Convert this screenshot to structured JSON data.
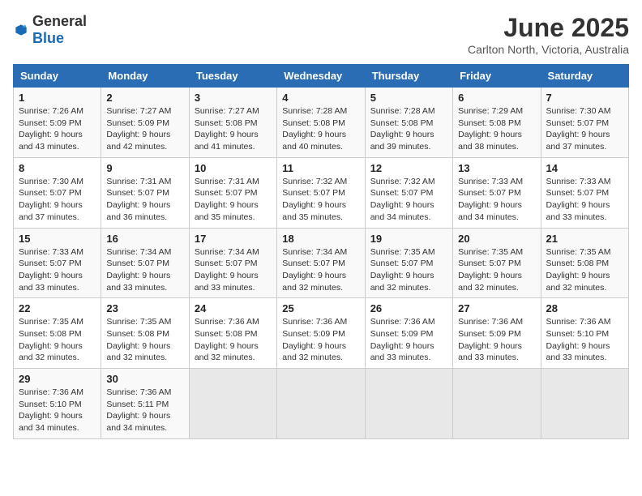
{
  "header": {
    "logo_general": "General",
    "logo_blue": "Blue",
    "month": "June 2025",
    "location": "Carlton North, Victoria, Australia"
  },
  "days_of_week": [
    "Sunday",
    "Monday",
    "Tuesday",
    "Wednesday",
    "Thursday",
    "Friday",
    "Saturday"
  ],
  "weeks": [
    [
      {
        "day": "1",
        "info": "Sunrise: 7:26 AM\nSunset: 5:09 PM\nDaylight: 9 hours\nand 43 minutes."
      },
      {
        "day": "2",
        "info": "Sunrise: 7:27 AM\nSunset: 5:09 PM\nDaylight: 9 hours\nand 42 minutes."
      },
      {
        "day": "3",
        "info": "Sunrise: 7:27 AM\nSunset: 5:08 PM\nDaylight: 9 hours\nand 41 minutes."
      },
      {
        "day": "4",
        "info": "Sunrise: 7:28 AM\nSunset: 5:08 PM\nDaylight: 9 hours\nand 40 minutes."
      },
      {
        "day": "5",
        "info": "Sunrise: 7:28 AM\nSunset: 5:08 PM\nDaylight: 9 hours\nand 39 minutes."
      },
      {
        "day": "6",
        "info": "Sunrise: 7:29 AM\nSunset: 5:08 PM\nDaylight: 9 hours\nand 38 minutes."
      },
      {
        "day": "7",
        "info": "Sunrise: 7:30 AM\nSunset: 5:07 PM\nDaylight: 9 hours\nand 37 minutes."
      }
    ],
    [
      {
        "day": "8",
        "info": "Sunrise: 7:30 AM\nSunset: 5:07 PM\nDaylight: 9 hours\nand 37 minutes."
      },
      {
        "day": "9",
        "info": "Sunrise: 7:31 AM\nSunset: 5:07 PM\nDaylight: 9 hours\nand 36 minutes."
      },
      {
        "day": "10",
        "info": "Sunrise: 7:31 AM\nSunset: 5:07 PM\nDaylight: 9 hours\nand 35 minutes."
      },
      {
        "day": "11",
        "info": "Sunrise: 7:32 AM\nSunset: 5:07 PM\nDaylight: 9 hours\nand 35 minutes."
      },
      {
        "day": "12",
        "info": "Sunrise: 7:32 AM\nSunset: 5:07 PM\nDaylight: 9 hours\nand 34 minutes."
      },
      {
        "day": "13",
        "info": "Sunrise: 7:33 AM\nSunset: 5:07 PM\nDaylight: 9 hours\nand 34 minutes."
      },
      {
        "day": "14",
        "info": "Sunrise: 7:33 AM\nSunset: 5:07 PM\nDaylight: 9 hours\nand 33 minutes."
      }
    ],
    [
      {
        "day": "15",
        "info": "Sunrise: 7:33 AM\nSunset: 5:07 PM\nDaylight: 9 hours\nand 33 minutes."
      },
      {
        "day": "16",
        "info": "Sunrise: 7:34 AM\nSunset: 5:07 PM\nDaylight: 9 hours\nand 33 minutes."
      },
      {
        "day": "17",
        "info": "Sunrise: 7:34 AM\nSunset: 5:07 PM\nDaylight: 9 hours\nand 33 minutes."
      },
      {
        "day": "18",
        "info": "Sunrise: 7:34 AM\nSunset: 5:07 PM\nDaylight: 9 hours\nand 32 minutes."
      },
      {
        "day": "19",
        "info": "Sunrise: 7:35 AM\nSunset: 5:07 PM\nDaylight: 9 hours\nand 32 minutes."
      },
      {
        "day": "20",
        "info": "Sunrise: 7:35 AM\nSunset: 5:07 PM\nDaylight: 9 hours\nand 32 minutes."
      },
      {
        "day": "21",
        "info": "Sunrise: 7:35 AM\nSunset: 5:08 PM\nDaylight: 9 hours\nand 32 minutes."
      }
    ],
    [
      {
        "day": "22",
        "info": "Sunrise: 7:35 AM\nSunset: 5:08 PM\nDaylight: 9 hours\nand 32 minutes."
      },
      {
        "day": "23",
        "info": "Sunrise: 7:35 AM\nSunset: 5:08 PM\nDaylight: 9 hours\nand 32 minutes."
      },
      {
        "day": "24",
        "info": "Sunrise: 7:36 AM\nSunset: 5:08 PM\nDaylight: 9 hours\nand 32 minutes."
      },
      {
        "day": "25",
        "info": "Sunrise: 7:36 AM\nSunset: 5:09 PM\nDaylight: 9 hours\nand 32 minutes."
      },
      {
        "day": "26",
        "info": "Sunrise: 7:36 AM\nSunset: 5:09 PM\nDaylight: 9 hours\nand 33 minutes."
      },
      {
        "day": "27",
        "info": "Sunrise: 7:36 AM\nSunset: 5:09 PM\nDaylight: 9 hours\nand 33 minutes."
      },
      {
        "day": "28",
        "info": "Sunrise: 7:36 AM\nSunset: 5:10 PM\nDaylight: 9 hours\nand 33 minutes."
      }
    ],
    [
      {
        "day": "29",
        "info": "Sunrise: 7:36 AM\nSunset: 5:10 PM\nDaylight: 9 hours\nand 34 minutes."
      },
      {
        "day": "30",
        "info": "Sunrise: 7:36 AM\nSunset: 5:11 PM\nDaylight: 9 hours\nand 34 minutes."
      },
      {
        "day": "",
        "info": ""
      },
      {
        "day": "",
        "info": ""
      },
      {
        "day": "",
        "info": ""
      },
      {
        "day": "",
        "info": ""
      },
      {
        "day": "",
        "info": ""
      }
    ]
  ]
}
